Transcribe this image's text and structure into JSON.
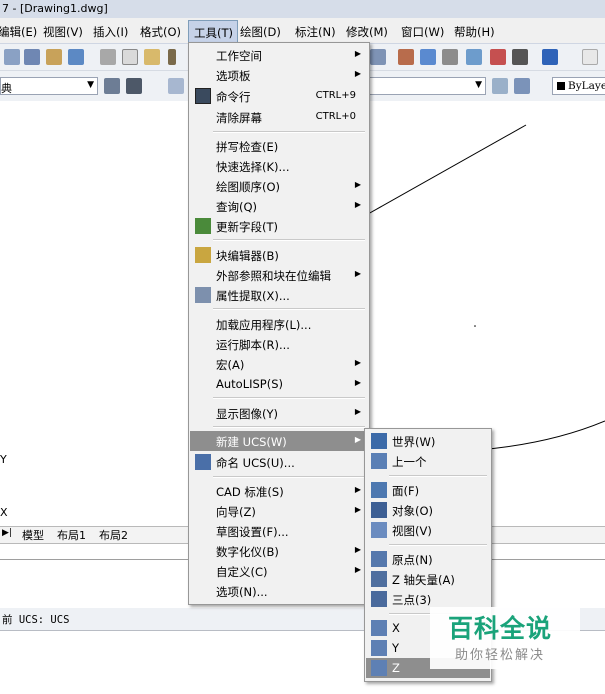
{
  "window": {
    "title": "7 - [Drawing1.dwg]"
  },
  "menubar": [
    {
      "key": "edit",
      "label": "编辑(E)"
    },
    {
      "key": "view",
      "label": "视图(V)"
    },
    {
      "key": "insert",
      "label": "插入(I)"
    },
    {
      "key": "format",
      "label": "格式(O)"
    },
    {
      "key": "tools",
      "label": "工具(T)"
    },
    {
      "key": "draw",
      "label": "绘图(D)"
    },
    {
      "key": "dimension",
      "label": "标注(N)"
    },
    {
      "key": "modify",
      "label": "修改(M)"
    },
    {
      "key": "window",
      "label": "窗口(W)"
    },
    {
      "key": "help",
      "label": "帮助(H)"
    }
  ],
  "toolbar": {
    "left_combo_value": "典",
    "bylayer_value": "ByLaye"
  },
  "canvas": {
    "left_label_y": "Y",
    "left_label_x": "X"
  },
  "layout_tabs": [
    "模型",
    "布局1",
    "布局2"
  ],
  "status": {
    "text": "前 UCS:  UCS"
  },
  "tools_menu": {
    "items": [
      {
        "label": "工作空间",
        "submenu": true
      },
      {
        "label": "选项板",
        "submenu": true
      },
      {
        "label": "命令行",
        "shortcut": "CTRL+9",
        "icon": "command-line-icon"
      },
      {
        "label": "清除屏幕",
        "shortcut": "CTRL+0"
      },
      {
        "label": "拼写检查(E)"
      },
      {
        "label": "快速选择(K)..."
      },
      {
        "label": "绘图顺序(O)",
        "submenu": true
      },
      {
        "label": "查询(Q)",
        "submenu": true
      },
      {
        "label": "更新字段(T)",
        "icon": "update-field-icon"
      },
      {
        "label": "块编辑器(B)",
        "icon": "block-editor-icon"
      },
      {
        "label": "外部参照和块在位编辑",
        "submenu": true
      },
      {
        "label": "属性提取(X)...",
        "icon": "attribute-extract-icon"
      },
      {
        "label": "加载应用程序(L)..."
      },
      {
        "label": "运行脚本(R)..."
      },
      {
        "label": "宏(A)",
        "submenu": true
      },
      {
        "label": "AutoLISP(S)",
        "submenu": true
      },
      {
        "label": "显示图像(Y)",
        "submenu": true
      },
      {
        "label": "新建 UCS(W)",
        "submenu": true,
        "highlighted": true
      },
      {
        "label": "命名 UCS(U)...",
        "icon": "named-ucs-icon"
      },
      {
        "label": "CAD 标准(S)",
        "submenu": true
      },
      {
        "label": "向导(Z)",
        "submenu": true
      },
      {
        "label": "草图设置(F)..."
      },
      {
        "label": "数字化仪(B)",
        "submenu": true
      },
      {
        "label": "自定义(C)",
        "submenu": true
      },
      {
        "label": "选项(N)..."
      }
    ]
  },
  "ucs_menu": {
    "items": [
      {
        "label": "世界(W)"
      },
      {
        "label": "上一个"
      },
      {
        "label": "面(F)"
      },
      {
        "label": "对象(O)"
      },
      {
        "label": "视图(V)"
      },
      {
        "label": "原点(N)"
      },
      {
        "label": "Z 轴矢量(A)"
      },
      {
        "label": "三点(3)"
      },
      {
        "label": "X"
      },
      {
        "label": "Y"
      },
      {
        "label": "Z",
        "highlighted": true
      }
    ]
  },
  "watermark": {
    "main": "百科全说",
    "sub": "助你轻松解决"
  },
  "colors": {
    "menu_highlight": "#8e8e8e",
    "menu_bg": "#f1f1f1",
    "watermark_green": "#1aa37a"
  }
}
